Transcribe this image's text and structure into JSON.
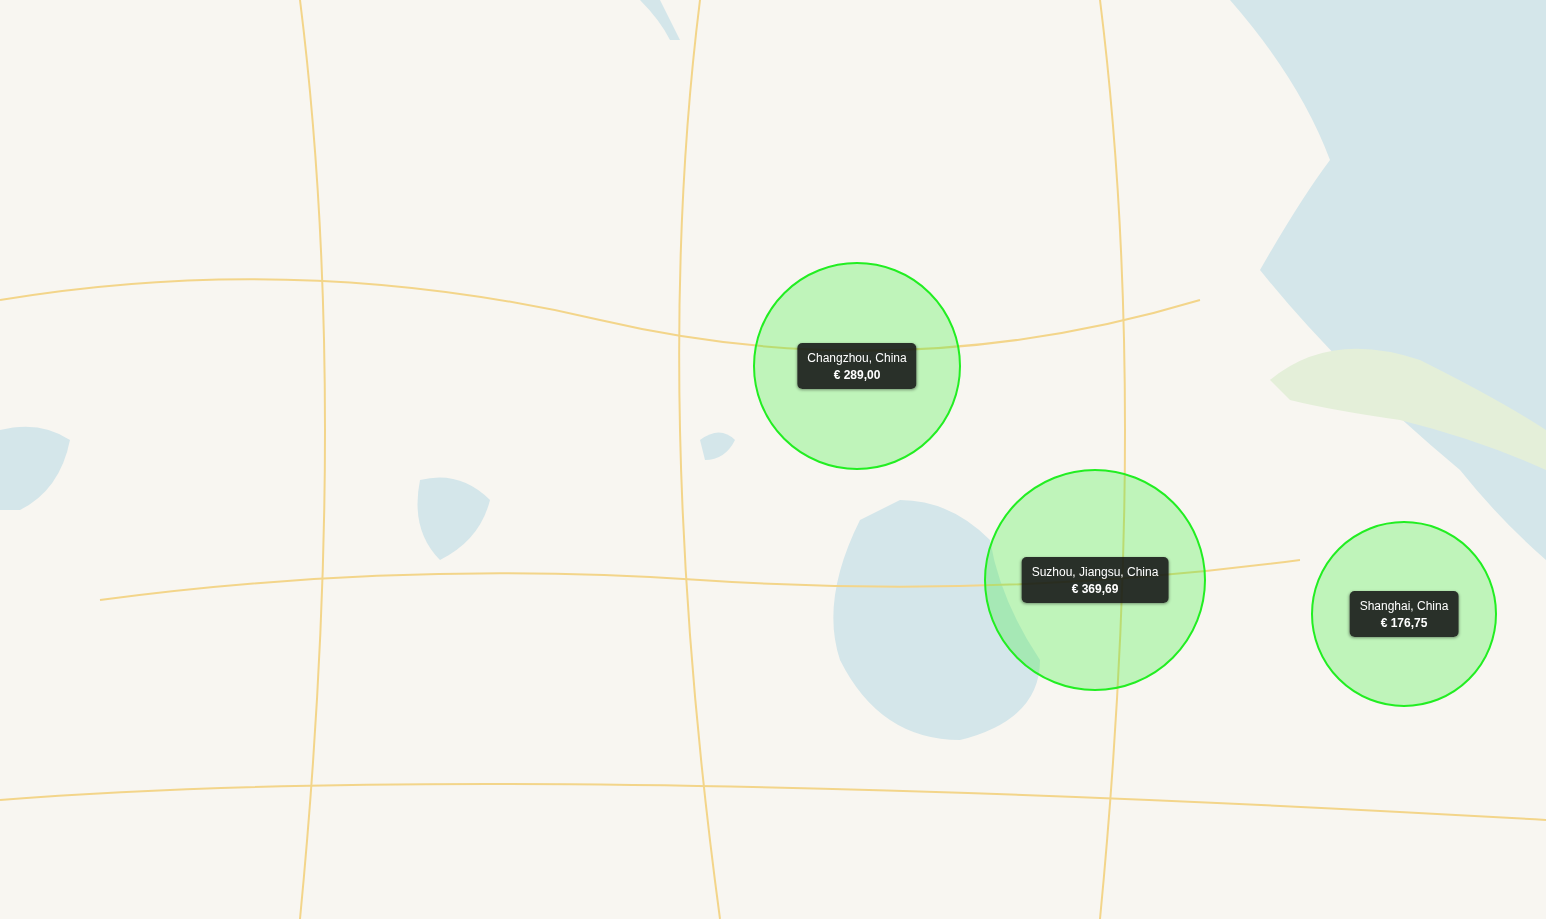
{
  "map": {
    "markers": [
      {
        "place": "Changzhou, China",
        "price": "€ 289,00"
      },
      {
        "place": "Suzhou, Jiangsu, China",
        "price": "€ 369,69"
      },
      {
        "place": "Shanghai, China",
        "price": "€ 176,75"
      }
    ]
  }
}
